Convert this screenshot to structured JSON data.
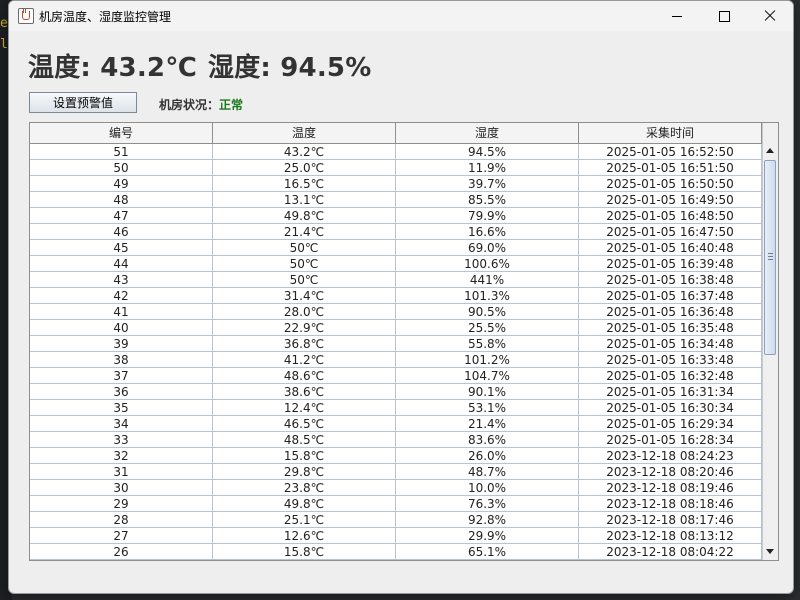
{
  "window": {
    "title": "机房温度、湿度监控管理"
  },
  "readings": {
    "temperature": "温度: 43.2℃",
    "humidity": "湿度: 94.5%"
  },
  "controls": {
    "set_threshold_label": "设置预警值",
    "status_label": "机房状况：",
    "status_value": "正常",
    "status_color": "#1a7a1a"
  },
  "table": {
    "columns": [
      "编号",
      "温度",
      "湿度",
      "采集时间"
    ],
    "rows": [
      [
        "51",
        "43.2℃",
        "94.5%",
        "2025-01-05 16:52:50"
      ],
      [
        "50",
        "25.0℃",
        "11.9%",
        "2025-01-05 16:51:50"
      ],
      [
        "49",
        "16.5℃",
        "39.7%",
        "2025-01-05 16:50:50"
      ],
      [
        "48",
        "13.1℃",
        "85.5%",
        "2025-01-05 16:49:50"
      ],
      [
        "47",
        "49.8℃",
        "79.9%",
        "2025-01-05 16:48:50"
      ],
      [
        "46",
        "21.4℃",
        "16.6%",
        "2025-01-05 16:47:50"
      ],
      [
        "45",
        "50℃",
        "69.0%",
        "2025-01-05 16:40:48"
      ],
      [
        "44",
        "50℃",
        "100.6%",
        "2025-01-05 16:39:48"
      ],
      [
        "43",
        "50℃",
        "441%",
        "2025-01-05 16:38:48"
      ],
      [
        "42",
        "31.4℃",
        "101.3%",
        "2025-01-05 16:37:48"
      ],
      [
        "41",
        "28.0℃",
        "90.5%",
        "2025-01-05 16:36:48"
      ],
      [
        "40",
        "22.9℃",
        "25.5%",
        "2025-01-05 16:35:48"
      ],
      [
        "39",
        "36.8℃",
        "55.8%",
        "2025-01-05 16:34:48"
      ],
      [
        "38",
        "41.2℃",
        "101.2%",
        "2025-01-05 16:33:48"
      ],
      [
        "37",
        "48.6℃",
        "104.7%",
        "2025-01-05 16:32:48"
      ],
      [
        "36",
        "38.6℃",
        "90.1%",
        "2025-01-05 16:31:34"
      ],
      [
        "35",
        "12.4℃",
        "53.1%",
        "2025-01-05 16:30:34"
      ],
      [
        "34",
        "46.5℃",
        "21.4%",
        "2025-01-05 16:29:34"
      ],
      [
        "33",
        "48.5℃",
        "83.6%",
        "2025-01-05 16:28:34"
      ],
      [
        "32",
        "15.8℃",
        "26.0%",
        "2023-12-18 08:24:23"
      ],
      [
        "31",
        "29.8℃",
        "48.7%",
        "2023-12-18 08:20:46"
      ],
      [
        "30",
        "23.8℃",
        "10.0%",
        "2023-12-18 08:19:46"
      ],
      [
        "29",
        "49.8℃",
        "76.3%",
        "2023-12-18 08:18:46"
      ],
      [
        "28",
        "25.1℃",
        "92.8%",
        "2023-12-18 08:17:46"
      ],
      [
        "27",
        "12.6℃",
        "29.9%",
        "2023-12-18 08:13:12"
      ],
      [
        "26",
        "15.8℃",
        "65.1%",
        "2023-12-18 08:04:22"
      ]
    ]
  },
  "background": {
    "glyphs": [
      "e",
      "l"
    ]
  }
}
